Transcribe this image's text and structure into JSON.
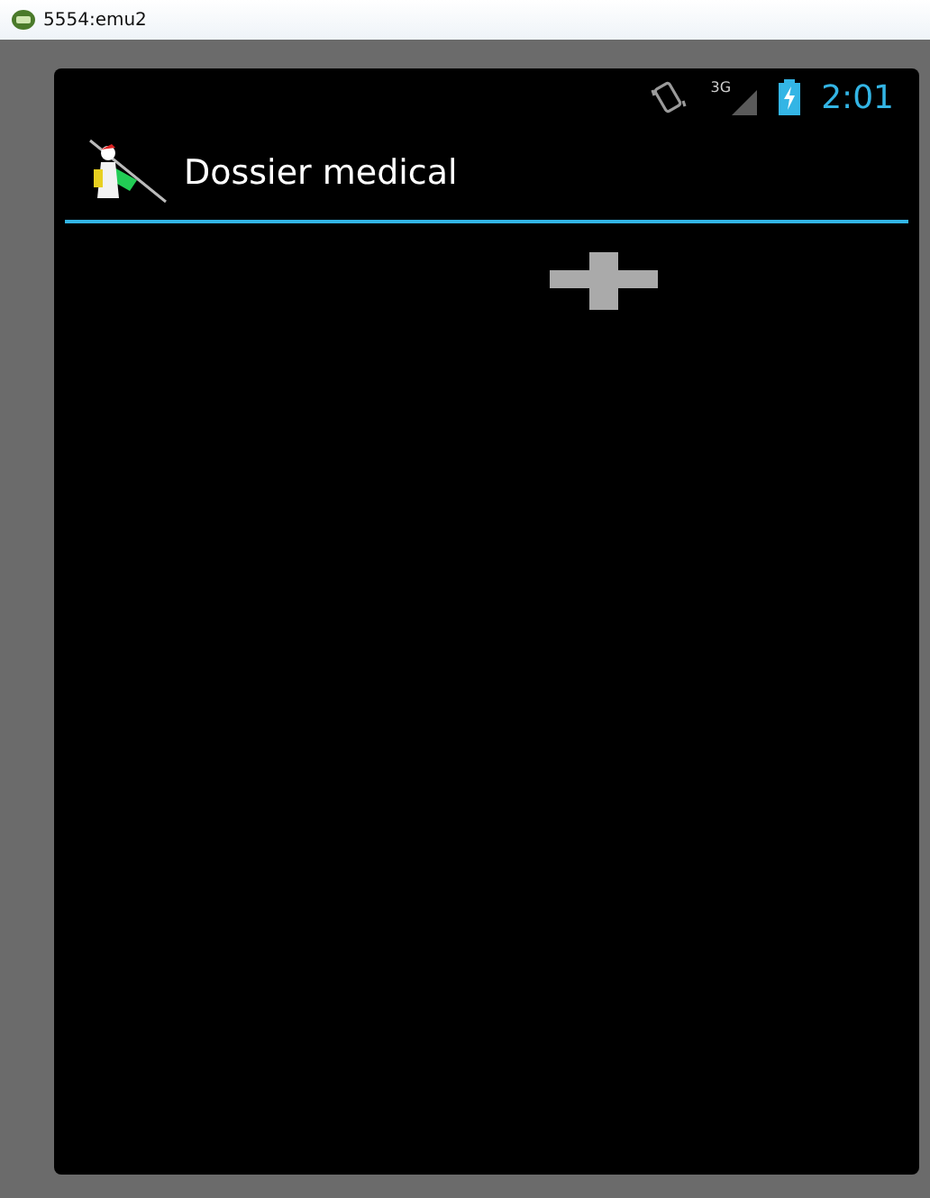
{
  "window": {
    "title": "5554:emu2"
  },
  "status_bar": {
    "network": "3G",
    "time": "2:01"
  },
  "action_bar": {
    "title": "Dossier medical"
  }
}
